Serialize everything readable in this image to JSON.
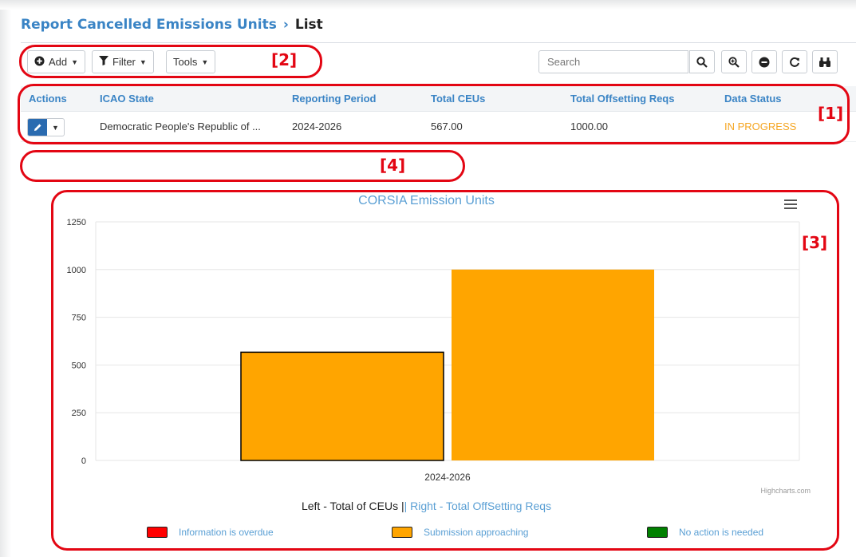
{
  "breadcrumb": {
    "title": "Report Cancelled Emissions Units",
    "separator": "›",
    "current": "List"
  },
  "toolbar": {
    "add_label": "Add",
    "filter_label": "Filter",
    "tools_label": "Tools",
    "search_placeholder": "Search",
    "icons": [
      "search-icon",
      "zoom-in-icon",
      "minus-circle-icon",
      "refresh-icon",
      "binoculars-icon"
    ]
  },
  "table": {
    "headers": [
      "Actions",
      "ICAO State",
      "Reporting Period",
      "Total CEUs",
      "Total Offsetting Reqs",
      "Data Status"
    ],
    "rows": [
      {
        "icao_state": "Democratic People's Republic of ...",
        "reporting_period": "2024-2026",
        "total_ceus": "567.00",
        "total_offsetting_reqs": "1000.00",
        "data_status": "IN PROGRESS"
      }
    ]
  },
  "annotations": [
    "[1]",
    "[2]",
    "[3]",
    "[4]"
  ],
  "colors": {
    "accent": "#3a84c5",
    "status_in_progress": "#f5a623",
    "bar": "#ffa500",
    "annotation": "#e30613"
  },
  "chart_data": {
    "type": "bar",
    "title": "CORSIA Emission Units",
    "categories": [
      "2024-2026"
    ],
    "series": [
      {
        "values": [
          567
        ]
      },
      {
        "values": [
          1000
        ]
      }
    ],
    "yticks": [
      0,
      250,
      500,
      750,
      1000,
      1250
    ],
    "ylim": [
      0,
      1250
    ],
    "grid": true,
    "credit": "Highcharts.com",
    "subtitle_left": "Left - Total of CEUs |",
    "subtitle_right": "| Right - Total OffSetting Reqs",
    "legend": [
      {
        "label": "Information is overdue",
        "color": "#ff0000"
      },
      {
        "label": "Submission approaching",
        "color": "#ffa500"
      },
      {
        "label": "No action is needed",
        "color": "#008000"
      }
    ]
  }
}
